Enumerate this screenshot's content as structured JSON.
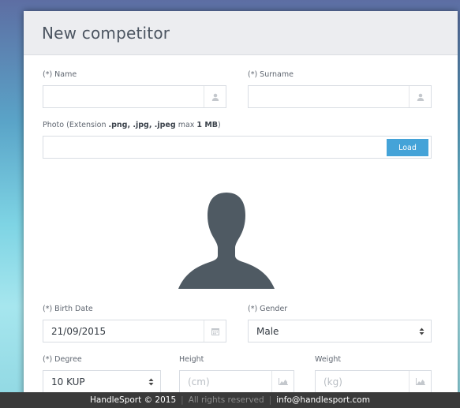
{
  "form": {
    "title": "New competitor",
    "name": {
      "label": "(*) Name",
      "value": ""
    },
    "surname": {
      "label": "(*) Surname",
      "value": ""
    },
    "photo": {
      "label_prefix": "Photo (Extension ",
      "label_ext": ".png, .jpg, .jpeg",
      "label_mid": " max ",
      "label_size": "1 MB",
      "label_suffix": ")",
      "value": "",
      "load_label": "Load"
    },
    "birth_date": {
      "label": "(*) Birth Date",
      "value": "21/09/2015"
    },
    "gender": {
      "label": "(*) Gender",
      "value": "Male"
    },
    "degree": {
      "label": "(*) Degree",
      "value": "10 KUP"
    },
    "height": {
      "label": "Height",
      "placeholder": "(cm)"
    },
    "weight": {
      "label": "Weight",
      "placeholder": "(kg)"
    }
  },
  "footer": {
    "brand": "HandleSport © 2015",
    "sep1": "|",
    "rights": "All rights reserved",
    "sep2": "|",
    "email": "info@handlesport.com"
  },
  "colors": {
    "accent": "#44a3d8",
    "avatar": "#4f5a63",
    "footer_bg": "#3a3a3a"
  },
  "icons": [
    "user-icon",
    "calendar-icon",
    "chart-icon",
    "select-caret-icon"
  ]
}
